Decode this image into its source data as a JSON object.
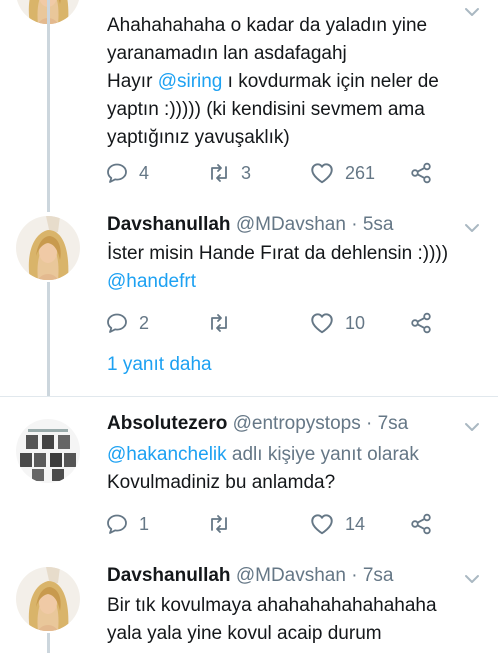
{
  "tweets": [
    {
      "text_lines": [
        "Ahahahahaha o kadar da yaladın yine",
        "yaranamadın lan asdafagahj"
      ],
      "line3_pre": "Hayır ",
      "line3_mention": "@siring",
      "line3_post": " ı kovdurmak için neler de",
      "text_lines2": [
        "yaptın :))))) (ki kendisini sevmem ama",
        "yaptığınız yavuşaklık)"
      ],
      "replies": "4",
      "retweets": "3",
      "likes": "261"
    },
    {
      "name": "Davshanullah",
      "handle": "@MDavshan",
      "time": "· 5sa",
      "line1": "İster misin Hande Fırat da dehlensin :))))",
      "line2_mention": "@handefrt",
      "replies": "2",
      "retweets": "",
      "likes": "10"
    },
    {
      "name": "Absolutezero",
      "handle": "@entropystops",
      "time": "· 7sa",
      "reply_mention": "@hakanchelik",
      "reply_suffix": " adlı kişiye yanıt olarak",
      "line2": "Kovulmadiniz bu anlamda?",
      "replies": "1",
      "retweets": "",
      "likes": "14"
    },
    {
      "name": "Davshanullah",
      "handle": "@MDavshan",
      "time": "· 7sa",
      "line1": "Bir tık kovulmaya ahahahahahahahaha",
      "line2": "yala yala yine kovul acaip durum"
    }
  ],
  "more_replies": "1 yanıt daha",
  "icons": {
    "reply": "reply-icon",
    "retweet": "retweet-icon",
    "like": "heart-icon",
    "share": "share-icon",
    "menu": "chevron-down-icon"
  },
  "colors": {
    "accent": "#1da1f2",
    "muted": "#657786",
    "text": "#14171a",
    "divider": "#e1e8ed",
    "thread": "#ccd6dd"
  }
}
